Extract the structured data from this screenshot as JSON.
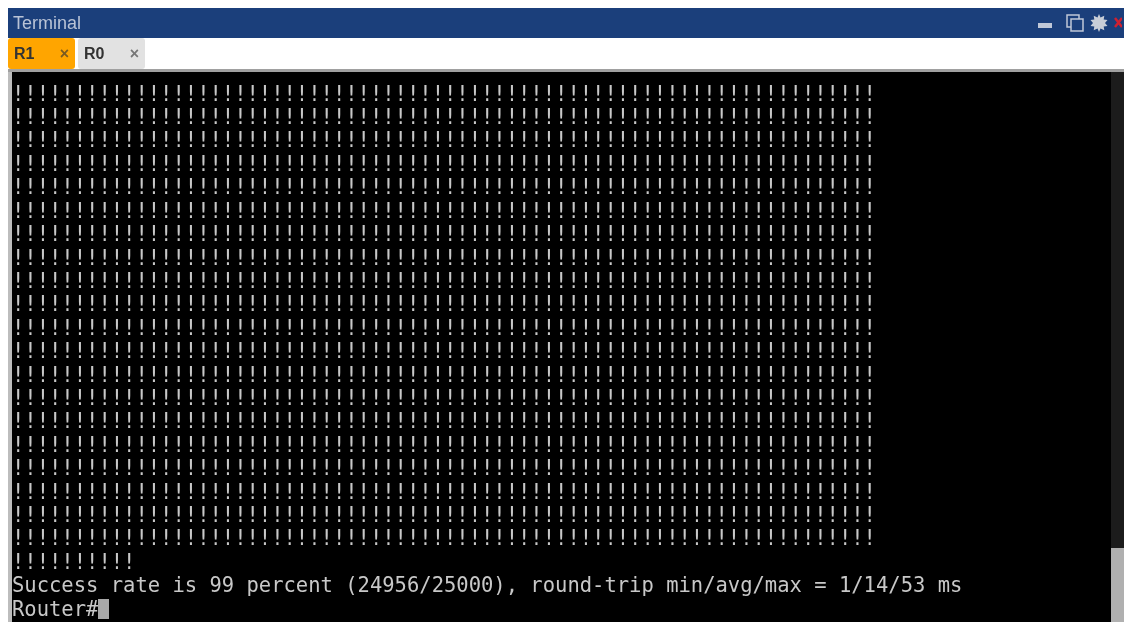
{
  "window": {
    "title": "Terminal"
  },
  "tabs": [
    {
      "label": "R1",
      "close": "×",
      "selected": true
    },
    {
      "label": "R0",
      "close": "×",
      "selected": false
    }
  ],
  "terminal": {
    "lines": [
      "!!!!!!!!!!!!!!!!!!!!!!!!!!!!!!!!!!!!!!!!!!!!!!!!!!!!!!!!!!!!!!!!!!!!!!",
      "!!!!!!!!!!!!!!!!!!!!!!!!!!!!!!!!!!!!!!!!!!!!!!!!!!!!!!!!!!!!!!!!!!!!!!",
      "!!!!!!!!!!!!!!!!!!!!!!!!!!!!!!!!!!!!!!!!!!!!!!!!!!!!!!!!!!!!!!!!!!!!!!",
      "!!!!!!!!!!!!!!!!!!!!!!!!!!!!!!!!!!!!!!!!!!!!!!!!!!!!!!!!!!!!!!!!!!!!!!",
      "!!!!!!!!!!!!!!!!!!!!!!!!!!!!!!!!!!!!!!!!!!!!!!!!!!!!!!!!!!!!!!!!!!!!!!",
      "!!!!!!!!!!!!!!!!!!!!!!!!!!!!!!!!!!!!!!!!!!!!!!!!!!!!!!!!!!!!!!!!!!!!!!",
      "!!!!!!!!!!!!!!!!!!!!!!!!!!!!!!!!!!!!!!!!!!!!!!!!!!!!!!!!!!!!!!!!!!!!!!",
      "!!!!!!!!!!!!!!!!!!!!!!!!!!!!!!!!!!!!!!!!!!!!!!!!!!!!!!!!!!!!!!!!!!!!!!",
      "!!!!!!!!!!!!!!!!!!!!!!!!!!!!!!!!!!!!!!!!!!!!!!!!!!!!!!!!!!!!!!!!!!!!!!",
      "!!!!!!!!!!!!!!!!!!!!!!!!!!!!!!!!!!!!!!!!!!!!!!!!!!!!!!!!!!!!!!!!!!!!!!",
      "!!!!!!!!!!!!!!!!!!!!!!!!!!!!!!!!!!!!!!!!!!!!!!!!!!!!!!!!!!!!!!!!!!!!!!",
      "!!!!!!!!!!!!!!!!!!!!!!!!!!!!!!!!!!!!!!!!!!!!!!!!!!!!!!!!!!!!!!!!!!!!!!",
      "!!!!!!!!!!!!!!!!!!!!!!!!!!!!!!!!!!!!!!!!!!!!!!!!!!!!!!!!!!!!!!!!!!!!!!",
      "!!!!!!!!!!!!!!!!!!!!!!!!!!!!!!!!!!!!!!!!!!!!!!!!!!!!!!!!!!!!!!!!!!!!!!",
      "!!!!!!!!!!!!!!!!!!!!!!!!!!!!!!!!!!!!!!!!!!!!!!!!!!!!!!!!!!!!!!!!!!!!!!",
      "!!!!!!!!!!!!!!!!!!!!!!!!!!!!!!!!!!!!!!!!!!!!!!!!!!!!!!!!!!!!!!!!!!!!!!",
      "!!!!!!!!!!!!!!!!!!!!!!!!!!!!!!!!!!!!!!!!!!!!!!!!!!!!!!!!!!!!!!!!!!!!!!",
      "!!!!!!!!!!!!!!!!!!!!!!!!!!!!!!!!!!!!!!!!!!!!!!!!!!!!!!!!!!!!!!!!!!!!!!",
      "!!!!!!!!!!!!!!!!!!!!!!!!!!!!!!!!!!!!!!!!!!!!!!!!!!!!!!!!!!!!!!!!!!!!!!",
      "!!!!!!!!!!!!!!!!!!!!!!!!!!!!!!!!!!!!!!!!!!!!!!!!!!!!!!!!!!!!!!!!!!!!!!",
      "!!!!!!!!!!",
      "Success rate is 99 percent (24956/25000), round-trip min/avg/max = 1/14/53 ms"
    ],
    "prompt": "Router#"
  }
}
